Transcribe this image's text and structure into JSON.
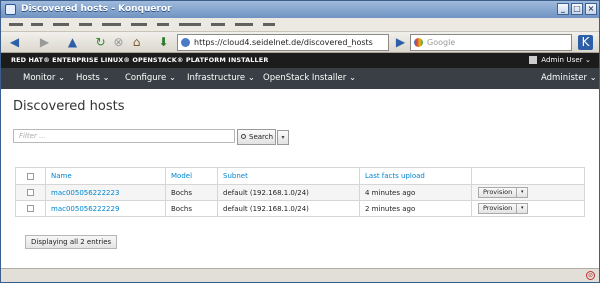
{
  "window": {
    "title": "Discovered hosts - Konqueror"
  },
  "browser": {
    "url": "https://cloud4.seidelnet.de/discovered_hosts",
    "search_placeholder": "Google"
  },
  "product_bar": {
    "brand": "RED HAT® ENTERPRISE LINUX® OPENSTACK® PLATFORM INSTALLER",
    "user": "Admin User ⌄"
  },
  "nav": {
    "items": [
      "Monitor ⌄",
      "Hosts ⌄",
      "Configure ⌄",
      "Infrastructure ⌄",
      "OpenStack Installer ⌄"
    ],
    "admin": "Administer ⌄"
  },
  "page": {
    "title": "Discovered hosts",
    "filter_placeholder": "Filter ...",
    "search_label": "Search",
    "entries_label": "Displaying all 2 entries"
  },
  "table": {
    "headers": [
      "Name",
      "Model",
      "Subnet",
      "Last facts upload"
    ],
    "rows": [
      {
        "name": "mac005056222223",
        "model": "Bochs",
        "subnet": "default (192.168.1.0/24)",
        "last_upload": "4 minutes ago",
        "action": "Provision"
      },
      {
        "name": "mac005056222229",
        "model": "Bochs",
        "subnet": "default (192.168.1.0/24)",
        "last_upload": "2 minutes ago",
        "action": "Provision"
      }
    ]
  }
}
